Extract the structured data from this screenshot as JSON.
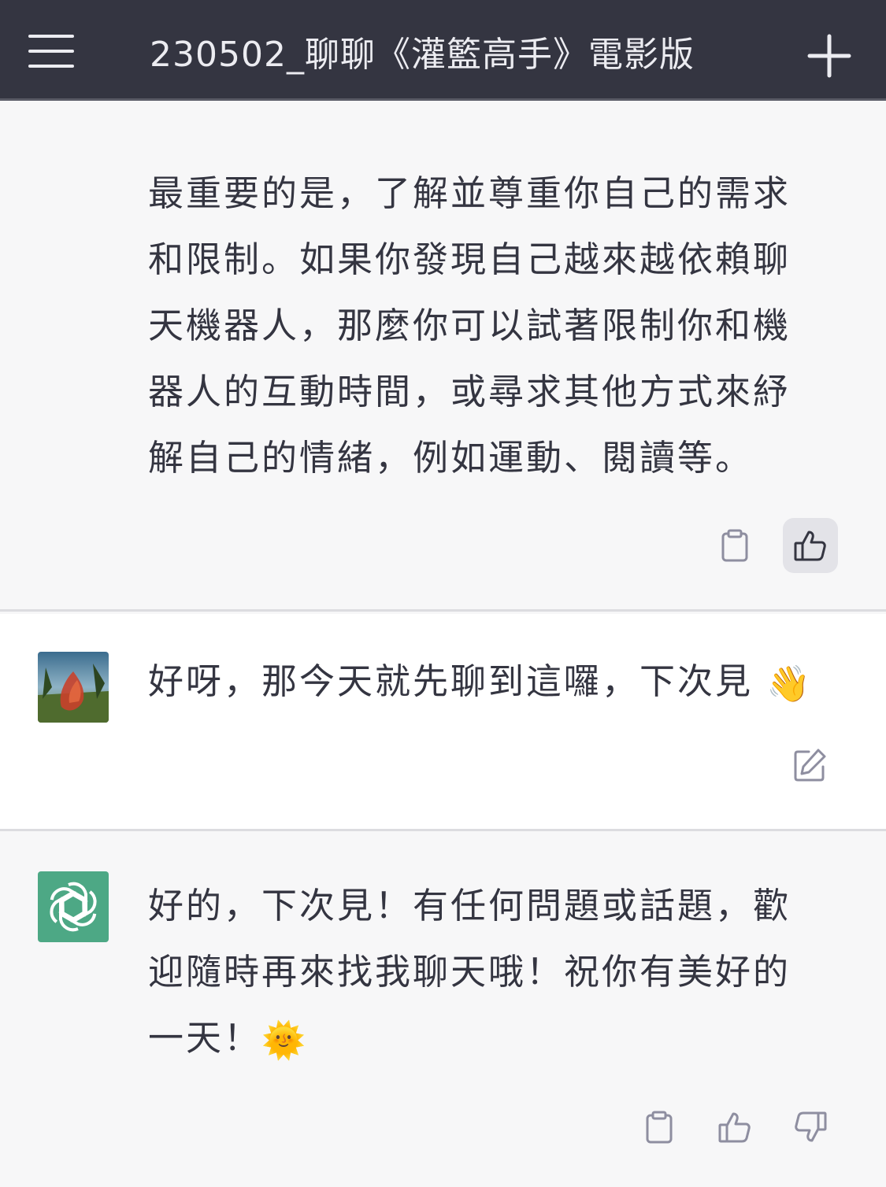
{
  "header": {
    "title": "230502_聊聊《灌籃高手》電影版",
    "menu_icon": "hamburger-menu-icon",
    "new_chat_icon": "plus-icon"
  },
  "messages": [
    {
      "role": "assistant",
      "text": "最重要的是，了解並尊重你自己的需求和限制。如果你發現自己越來越依賴聊天機器人，那麼你可以試著限制你和機器人的互動時間，或尋求其他方式來紓解自己的情緒，例如運動、閱讀等。",
      "actions": [
        "clipboard-icon",
        "thumbs-up-icon"
      ]
    },
    {
      "role": "user",
      "text": "好呀，那今天就先聊到這囉，下次見",
      "emoji": "👋",
      "actions": [
        "edit-icon"
      ]
    },
    {
      "role": "assistant",
      "text": "好的，下次見！有任何問題或話題，歡迎隨時再來找我聊天哦！祝你有美好的一天！",
      "emoji": "🌞",
      "actions": [
        "clipboard-icon",
        "thumbs-up-icon",
        "thumbs-down-icon"
      ]
    }
  ],
  "colors": {
    "header_bg": "#343541",
    "assistant_bg": "#f7f7f8",
    "user_bg": "#ffffff",
    "assistant_avatar": "#4da885",
    "text": "#343541"
  }
}
